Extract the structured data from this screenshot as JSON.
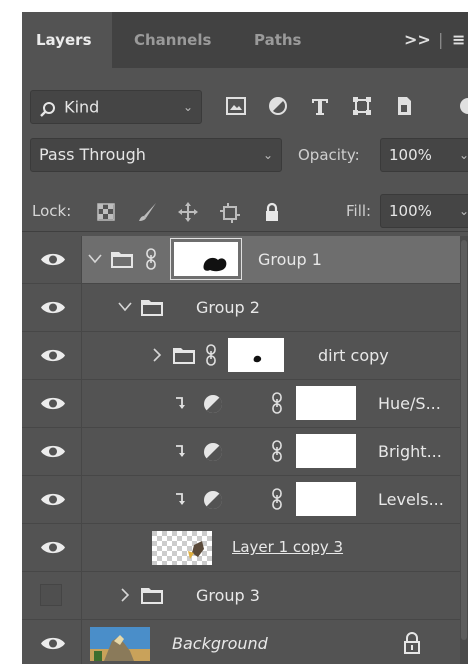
{
  "tabs": {
    "layers": "Layers",
    "channels": "Channels",
    "paths": "Paths",
    "more": ">>",
    "menu": "≡"
  },
  "filter": {
    "kind_label": "Kind",
    "icons": [
      "pixel-filter-icon",
      "adjustment-filter-icon",
      "type-filter-icon",
      "shape-filter-icon",
      "smart-object-filter-icon"
    ]
  },
  "blend": {
    "mode": "Pass Through",
    "opacity_label": "Opacity:",
    "opacity_value": "100%"
  },
  "lock": {
    "label": "Lock:",
    "fill_label": "Fill:",
    "fill_value": "100%"
  },
  "layers": [
    {
      "name": "Group 1",
      "type": "group",
      "visible": true,
      "selected": true,
      "expanded": true
    },
    {
      "name": "Group 2",
      "type": "group",
      "visible": true,
      "expanded": true
    },
    {
      "name": "dirt copy",
      "type": "group",
      "visible": true,
      "expanded": false
    },
    {
      "name": "Hue/S...",
      "type": "adjustment",
      "visible": true
    },
    {
      "name": "Bright...",
      "type": "adjustment",
      "visible": true
    },
    {
      "name": "Levels...",
      "type": "adjustment",
      "visible": true
    },
    {
      "name": "Layer 1 copy 3",
      "type": "pixel",
      "visible": true
    },
    {
      "name": "Group 3",
      "type": "group",
      "visible": false,
      "expanded": false
    },
    {
      "name": "Background",
      "type": "background",
      "visible": true,
      "locked": true
    }
  ],
  "colors": {
    "panel": "#535353",
    "tabbar": "#424242",
    "selected": "#6e6e6e",
    "text": "#e8e8e8"
  }
}
